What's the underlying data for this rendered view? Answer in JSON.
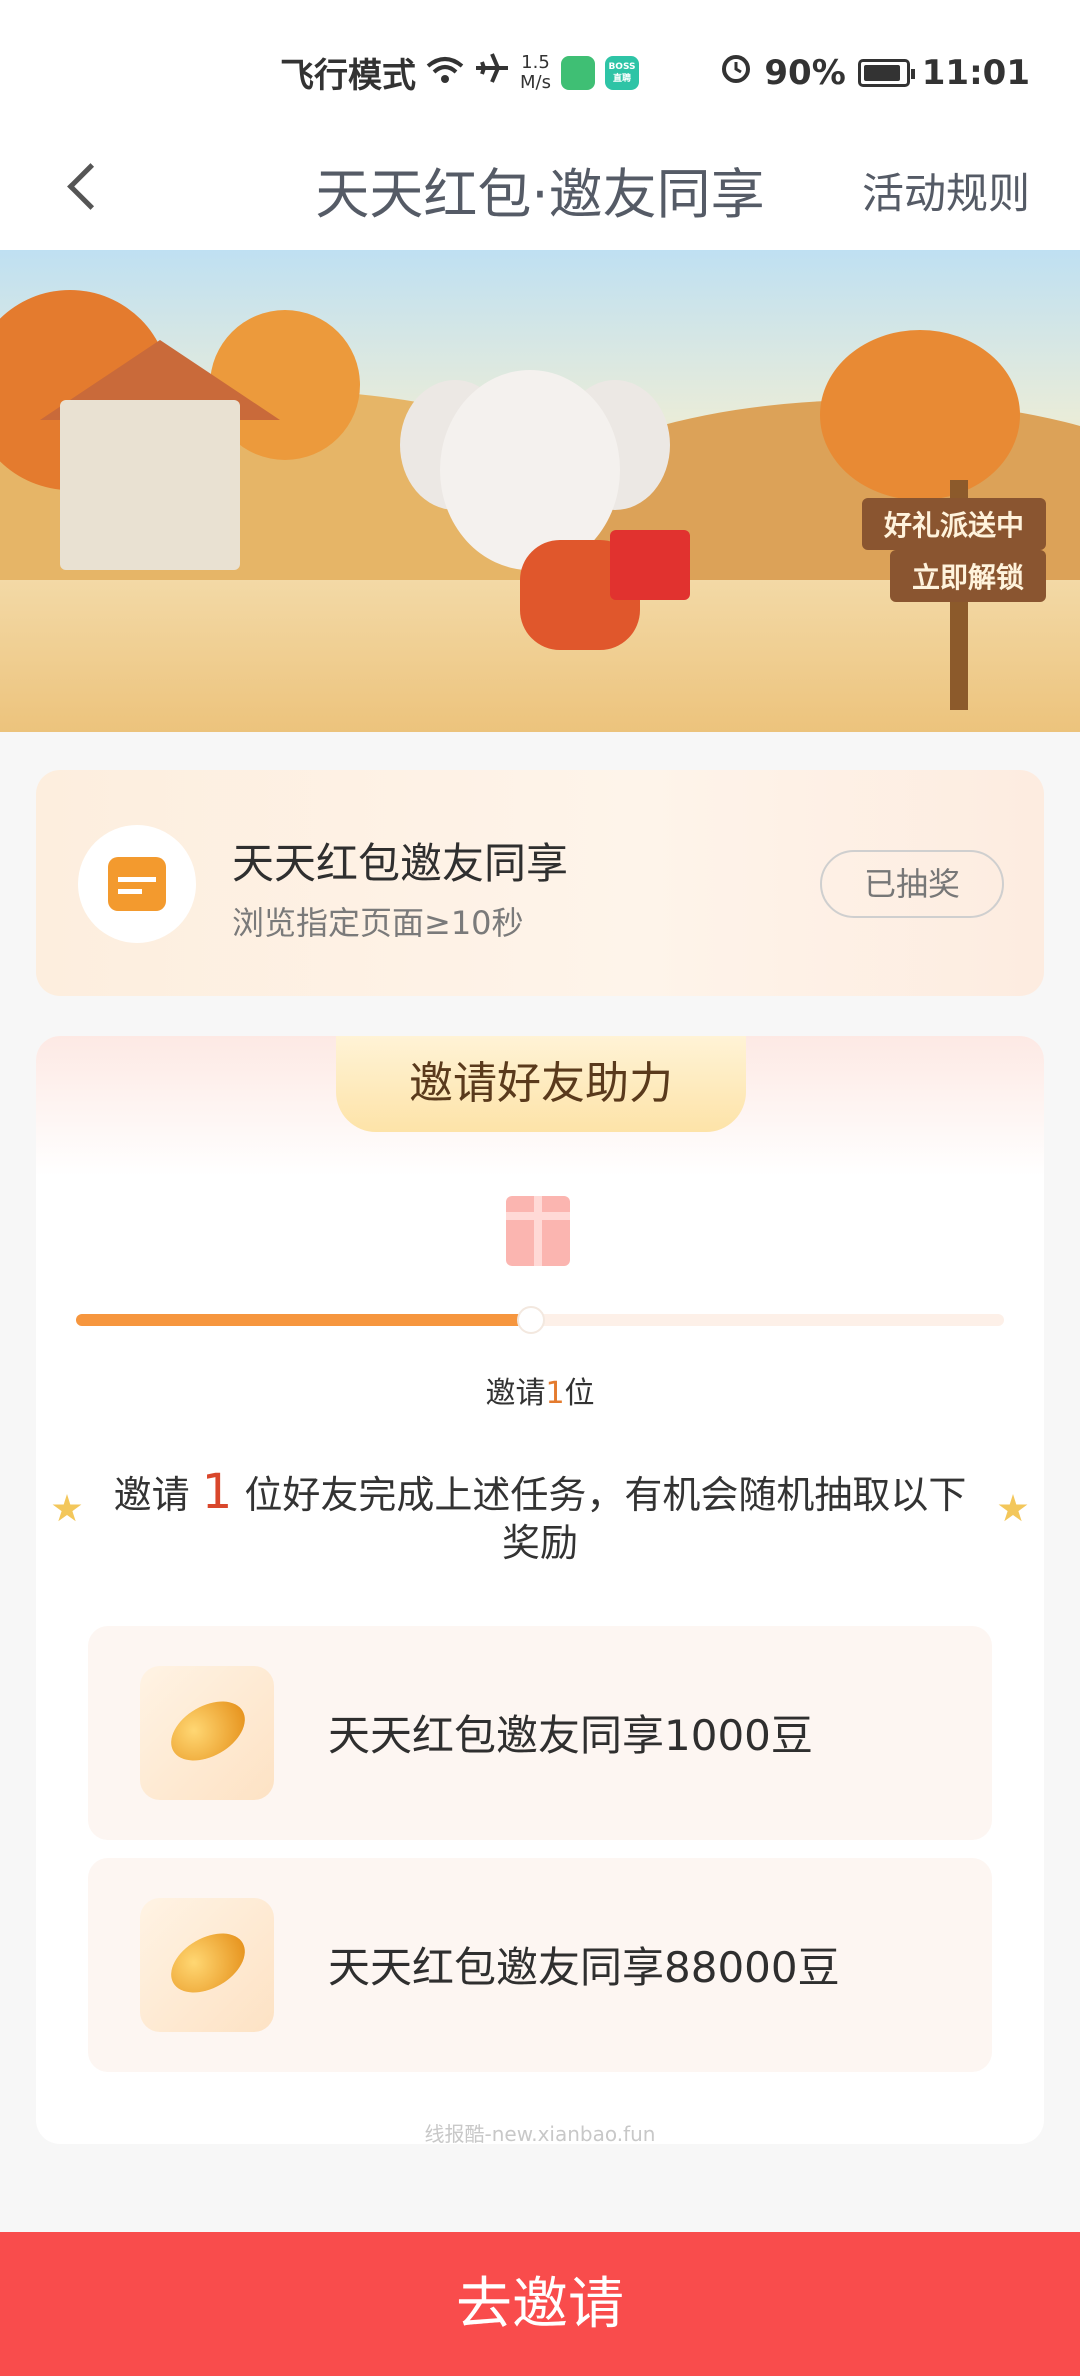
{
  "status_bar": {
    "airplane_mode": "飞行模式",
    "speed_value": "1.5",
    "speed_unit": "M/s",
    "boss_badge": "BOSS直聘",
    "battery": "90%",
    "battery_level": 0.9,
    "time": "11:01",
    "icons": [
      "wifi-icon",
      "airplane-icon",
      "alarm-icon",
      "battery-icon"
    ]
  },
  "nav": {
    "title": "天天红包·邀友同享",
    "rules": "活动规则"
  },
  "banner": {
    "sign_line1": "好礼派送中",
    "sign_line2": "立即解锁"
  },
  "task": {
    "title": "天天红包邀友同享",
    "subtitle": "浏览指定页面≥10秒",
    "button": "已抽奖"
  },
  "invite": {
    "tab_title": "邀请好友助力",
    "progress_fraction": 0.49,
    "progress_label_prefix": "邀请",
    "progress_label_num": "1",
    "progress_label_suffix": "位",
    "desc_prefix": "邀请 ",
    "desc_num": "1",
    "desc_suffix": " 位好友完成上述任务，有机会随机抽取以下奖励",
    "rewards": [
      {
        "label": "天天红包邀友同享1000豆",
        "icon": "bean-icon"
      },
      {
        "label": "天天红包邀友同享88000豆",
        "icon": "bean-icon"
      }
    ]
  },
  "watermark": "线报酷-new.xianbao.fun",
  "bottom_button": "去邀请",
  "colors": {
    "accent": "#f6963e",
    "button": "#f94c4c",
    "highlight": "#d9472c"
  }
}
